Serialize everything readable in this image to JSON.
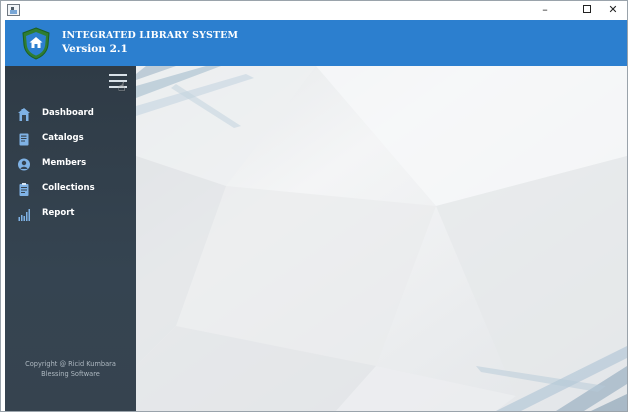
{
  "window": {
    "controls": {
      "minimize": "–",
      "maximize": "",
      "close": "✕"
    }
  },
  "header": {
    "title": "INTEGRATED LIBRARY SYSTEM",
    "version": "Version 2.1",
    "logo_icon": "shield-home-icon",
    "colors": {
      "background": "#2c7fcf",
      "logo_outer": "#2e7d32",
      "logo_inner": "#2c7fcf"
    }
  },
  "sidebar": {
    "menu_icon": "hamburger-menu-icon",
    "items": [
      {
        "label": "Dashboard",
        "icon": "home-icon"
      },
      {
        "label": "Catalogs",
        "icon": "book-icon"
      },
      {
        "label": "Members",
        "icon": "member-icon"
      },
      {
        "label": "Collections",
        "icon": "clipboard-icon"
      },
      {
        "label": "Report",
        "icon": "bar-chart-icon"
      }
    ],
    "copyright_line1": "Copyright @ Ricid Kumbara",
    "copyright_line2": "Blessing Software",
    "colors": {
      "background": "#36434f",
      "icon": "#7fb2e5",
      "text": "#ffffff"
    }
  }
}
